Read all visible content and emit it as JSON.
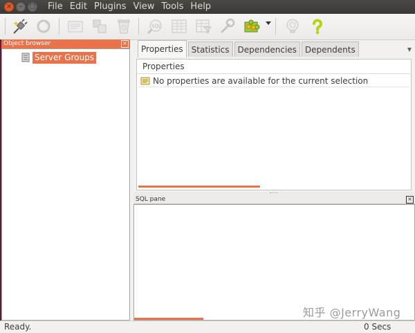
{
  "menubar": {
    "items": [
      "File",
      "Edit",
      "Plugins",
      "View",
      "Tools",
      "Help"
    ]
  },
  "toolbar": {
    "buttons": [
      {
        "icon": "connect-plug-icon",
        "enabled": true
      },
      {
        "icon": "refresh-icon",
        "enabled": false
      },
      {
        "icon": "properties-icon",
        "enabled": false
      },
      {
        "icon": "create-object-icon",
        "enabled": false
      },
      {
        "icon": "drop-object-icon",
        "enabled": false
      },
      {
        "icon": "sql-query-icon",
        "enabled": false
      },
      {
        "icon": "view-data-icon",
        "enabled": false
      },
      {
        "icon": "filtered-data-icon",
        "enabled": false
      },
      {
        "icon": "maintenance-wrench-icon",
        "enabled": false
      },
      {
        "icon": "plugins-puzzle-icon",
        "enabled": true
      },
      {
        "icon": "hint-icon",
        "enabled": false
      },
      {
        "icon": "help-question-icon",
        "enabled": true
      }
    ]
  },
  "object_browser": {
    "title": "Object browser",
    "tree": [
      {
        "label": "Server Groups",
        "selected": true
      }
    ]
  },
  "notebook": {
    "tabs": [
      "Properties",
      "Statistics",
      "Dependencies",
      "Dependents"
    ],
    "active_tab": "Properties",
    "properties": {
      "header": "Properties",
      "rows": [
        "No properties are available for the current selection"
      ]
    }
  },
  "sql_pane": {
    "title": "SQL pane",
    "content": ""
  },
  "statusbar": {
    "left": "Ready.",
    "right": "0 Secs"
  },
  "watermark": "知乎 @JerryWang",
  "colors": {
    "accent": "#e8734a",
    "menubar": "#3c3b37",
    "window_close": "#e25a24"
  }
}
